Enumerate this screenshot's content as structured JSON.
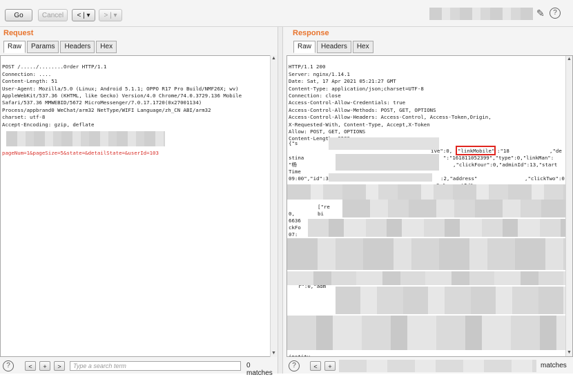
{
  "toolbar": {
    "go_label": "Go",
    "cancel_label": "Cancel",
    "back_label": "< | ▾",
    "forward_label": "> | ▾",
    "edit_icon": "pencil-icon",
    "help_icon": "help-icon"
  },
  "request": {
    "title": "Request",
    "tabs": [
      "Raw",
      "Params",
      "Headers",
      "Hex"
    ],
    "active_tab": "Raw",
    "lines": [
      "POST /...../........Order HTTP/1.1",
      "Connection: ....",
      "Content-Length: 51",
      "User-Agent: Mozilla/5.0 (Linux; Android 5.1.1; OPPO R17 Pro Build/NMF26X; wv)",
      "AppleWebKit/537.36 (KHTML, like Gecko) Version/4.0 Chrome/74.0.3729.136 Mobile",
      "Safari/537.36 MMWEBID/5672 MicroMessenger/7.0.17.1720(0x27001134)",
      "Process/appbrand0 WeChat/arm32 NetType/WIFI Language/zh_CN ABI/arm32",
      "charset: utf-8",
      "Accept-Encoding: gzip, deflate",
      "",
      "",
      "",
      "pageNum=1&pageSize=5&state=&detailState=&userId=103"
    ],
    "search_placeholder": "Type a search term",
    "matches": "0 matches"
  },
  "response": {
    "title": "Response",
    "tabs": [
      "Raw",
      "Headers",
      "Hex"
    ],
    "active_tab": "Raw",
    "lines": [
      "HTTP/1.1 200",
      "Server: nginx/1.14.1",
      "Date: Sat, 17 Apr 2021 05:21:27 GMT",
      "Content-Type: application/json;charset=UTF-8",
      "Connection: close",
      "Access-Control-Allow-Credentials: true",
      "Access-Control-Allow-Methods: POST, GET, OPTIONS",
      "Access-Control-Allow-Headers: Access-Control, Access-Token,Origin,",
      "X-Requested-With, Content-Type, Accept,X-Token",
      "Allow: POST, GET, OPTIONS",
      "Content-Length: 3289"
    ],
    "fragments": {
      "f1": "{\"s",
      "f2": "ive\":0,",
      "f3": "\"linkMobile\"",
      "f4": ":\"18",
      "f5": ",\"de",
      "f6": "stina",
      "f7": "\":\"161811052399\",\"type\":0,\"linkMan\":",
      "f8": "\"杨",
      "f9": ",\"clickFour\":0,\"adminId\":13,\"start",
      "f10": "Time",
      "f11": "09:00\",\"id\":3940,\"personalAmount",
      "f12": ":2,\"address\"",
      "f13": ",\"clickTwo\":0,\"",
      "f14": "3,\"parentId\"",
      "f15": "[\"re",
      "f16": "0,",
      "f17": "bi",
      "f18": "6636",
      "f19": "ckFo",
      "f20": "07:",
      "f21": "r\":0,\"adm",
      "f22": "institu",
      "f23": "ti"
    },
    "matches": "matches"
  }
}
